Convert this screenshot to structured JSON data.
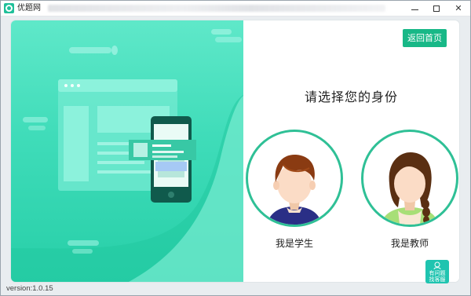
{
  "window": {
    "title": "优题网",
    "minimize_icon": "minimize-icon",
    "maximize_icon": "maximize-icon",
    "close_icon": "close-icon"
  },
  "header": {
    "home_button_label": "返回首页"
  },
  "main": {
    "heading": "请选择您的身份",
    "roles": [
      {
        "label": "我是学生",
        "avatar": "student-avatar"
      },
      {
        "label": "我是教师",
        "avatar": "teacher-avatar"
      }
    ]
  },
  "help": {
    "label": "有问题找客服",
    "icon": "customer-service-icon"
  },
  "footer": {
    "version": "version:1.0.15"
  },
  "colors": {
    "accent": "#18b887",
    "hero_top": "#5fe8c9",
    "hero_bottom": "#27cfa8",
    "ring": "#2fc096",
    "help": "#1fc4b0"
  }
}
